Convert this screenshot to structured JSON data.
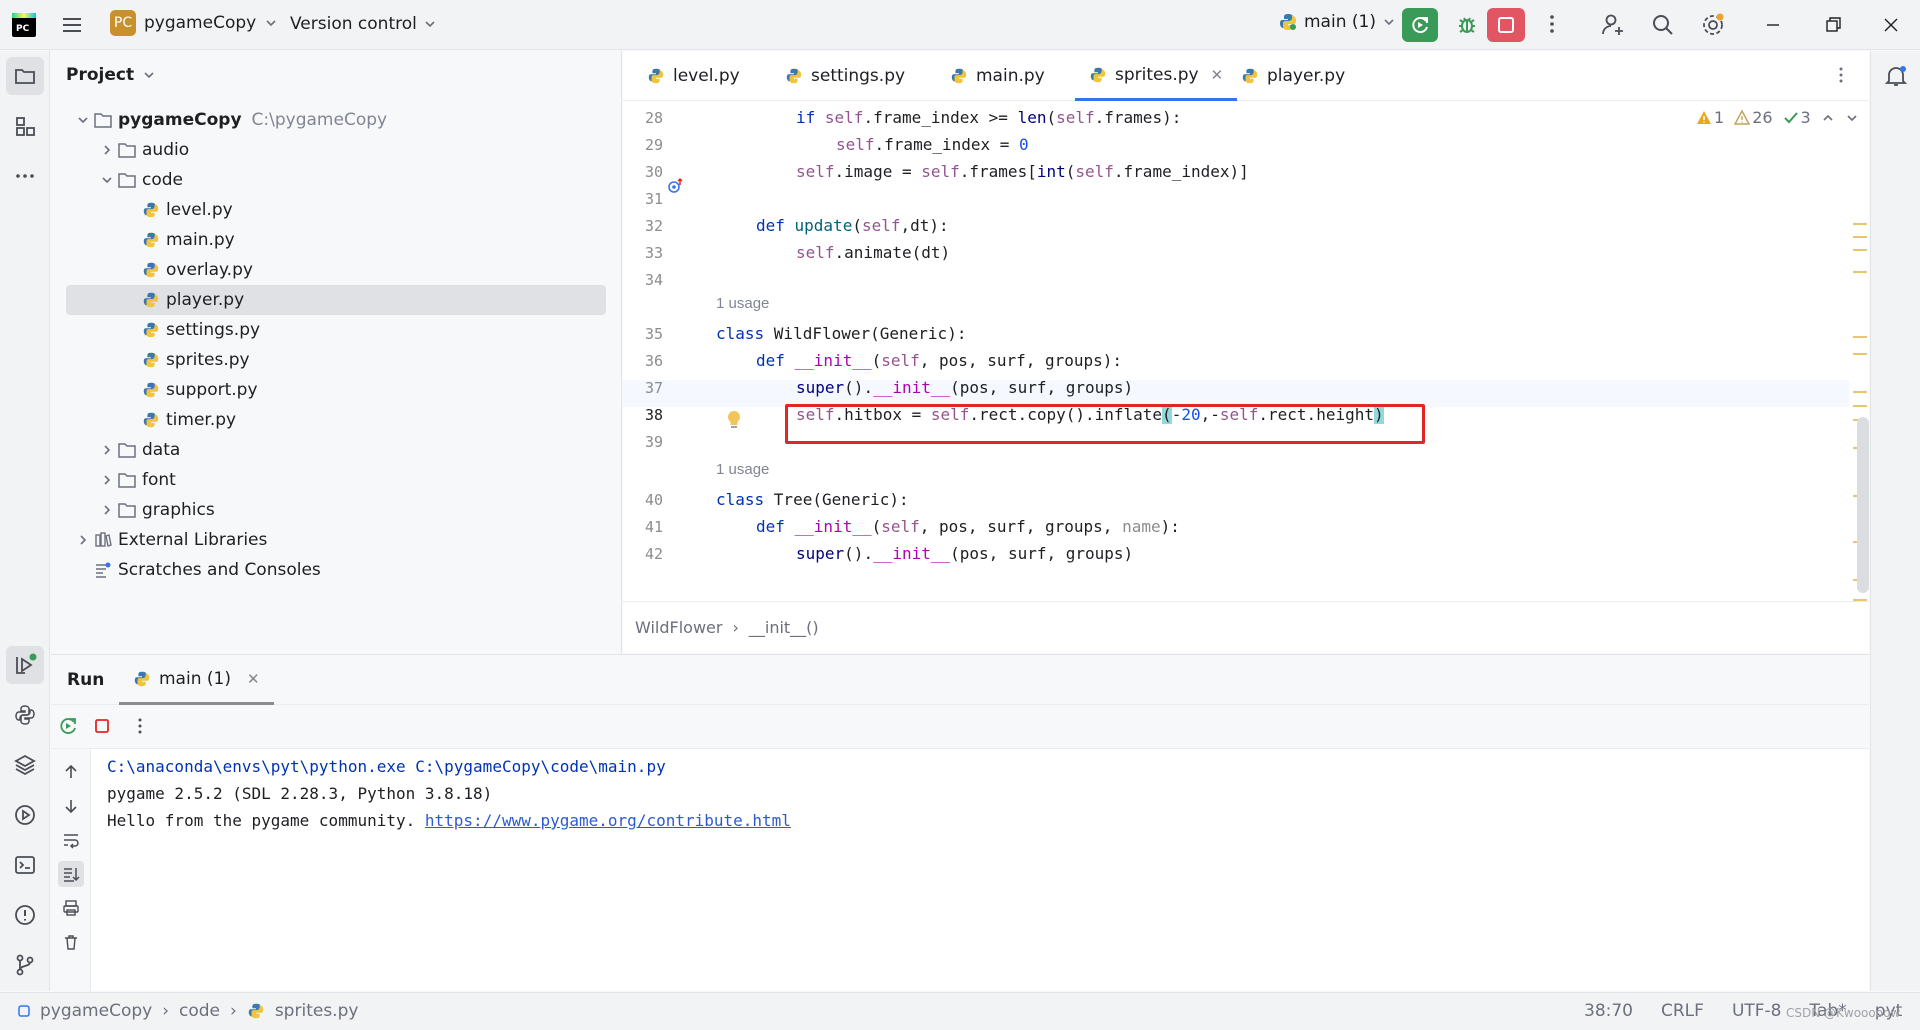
{
  "titlebar": {
    "project_badge": "PC",
    "project_name": "pygameCopy",
    "version_control": "Version control",
    "run_config": "main (1)"
  },
  "project_panel": {
    "title": "Project",
    "tree": [
      {
        "label": "pygameCopy",
        "path": "C:\\pygameCopy",
        "type": "root",
        "expanded": true
      },
      {
        "label": "audio",
        "type": "folder",
        "expanded": false
      },
      {
        "label": "code",
        "type": "folder",
        "expanded": true
      },
      {
        "label": "level.py",
        "type": "python-file"
      },
      {
        "label": "main.py",
        "type": "python-file"
      },
      {
        "label": "overlay.py",
        "type": "python-file"
      },
      {
        "label": "player.py",
        "type": "python-file",
        "selected": true
      },
      {
        "label": "settings.py",
        "type": "python-file"
      },
      {
        "label": "sprites.py",
        "type": "python-file"
      },
      {
        "label": "support.py",
        "type": "python-file"
      },
      {
        "label": "timer.py",
        "type": "python-file"
      },
      {
        "label": "data",
        "type": "folder",
        "expanded": false
      },
      {
        "label": "font",
        "type": "folder",
        "expanded": false
      },
      {
        "label": "graphics",
        "type": "folder",
        "expanded": false
      },
      {
        "label": "External Libraries",
        "type": "library",
        "expanded": false
      },
      {
        "label": "Scratches and Consoles",
        "type": "scratches"
      }
    ]
  },
  "editor": {
    "tabs": [
      {
        "label": "level.py",
        "active": false
      },
      {
        "label": "settings.py",
        "active": false
      },
      {
        "label": "main.py",
        "active": false
      },
      {
        "label": "sprites.py",
        "active": true,
        "closable": true
      },
      {
        "label": "player.py",
        "active": false
      }
    ],
    "inspections": {
      "errors": "1",
      "warnings": "26",
      "ok": "3"
    },
    "line_numbers": [
      "28",
      "29",
      "30",
      "31",
      "32",
      "33",
      "34",
      "35",
      "36",
      "37",
      "38",
      "39",
      "40",
      "41",
      "42"
    ],
    "current_line": "38",
    "usage_hints": [
      "1 usage",
      "1 usage"
    ],
    "code_lines": {
      "l28": "if self.frame_index >= len(self.frames):",
      "l29": "self.frame_index = 0",
      "l30": "self.image = self.frames[int(self.frame_index)]",
      "l32": "def update(self,dt):",
      "l33": "self.animate(dt)",
      "l35": "class WildFlower(Generic):",
      "l36": "def __init__(self, pos, surf, groups):",
      "l37": "super().__init__(pos, surf, groups)",
      "l38": "self.hitbox = self.rect.copy().inflate(-20,-self.rect.height)",
      "l40": "class Tree(Generic):",
      "l41": "def __init__(self, pos, surf, groups, name):",
      "l42": "super().__init__(pos, surf, groups)"
    },
    "breadcrumb": [
      "WildFlower",
      "__init__()"
    ]
  },
  "run_panel": {
    "title": "Run",
    "tab_label": "main (1)",
    "console": [
      "C:\\anaconda\\envs\\pyt\\python.exe C:\\pygameCopy\\code\\main.py",
      "pygame 2.5.2 (SDL 2.28.3, Python 3.8.18)",
      "Hello from the pygame community. "
    ],
    "console_link": "https://www.pygame.org/contribute.html"
  },
  "statusbar": {
    "crumbs": [
      "pygameCopy",
      "code",
      "sprites.py"
    ],
    "position": "38:70",
    "line_sep": "CRLF",
    "encoding": "UTF-8",
    "indent": "Tab*",
    "lang": "pyt",
    "watermark": "CSDN @Kwooooow"
  },
  "colors": {
    "accent": "#3574f0",
    "run_green": "#3a9a57",
    "stop_red": "#e25563",
    "highlight_box": "#e02727",
    "keyword": "#0033b3",
    "self": "#94558d",
    "number": "#1750eb"
  },
  "icons": [
    "hamburger-menu-icon",
    "chevron-down-icon",
    "rerun-icon",
    "debug-icon",
    "stop-icon",
    "more-icon",
    "add-user-icon",
    "search-icon",
    "settings-icon",
    "minimize-icon",
    "restore-icon",
    "close-icon",
    "folder-icon",
    "python-file-icon",
    "bell-icon",
    "lightbulb-icon",
    "override-icon"
  ]
}
